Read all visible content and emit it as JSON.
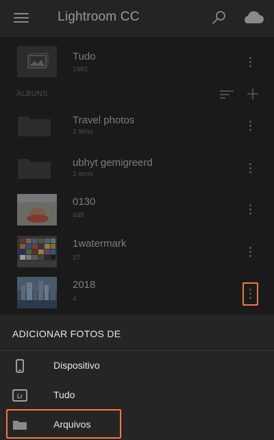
{
  "header": {
    "title": "Lightroom CC",
    "menu_icon": "hamburger-icon",
    "search_icon": "search-icon",
    "cloud_icon": "cloud-icon"
  },
  "all_photos": {
    "title": "Tudo",
    "count": "1982"
  },
  "albums_section": {
    "label": "ÁLBUNS"
  },
  "albums": [
    {
      "title": "Travel photos",
      "subtitle": "2 itens",
      "kind": "folder"
    },
    {
      "title": "ubhyt gemigreerd",
      "subtitle": "2 itens",
      "kind": "folder"
    },
    {
      "title": "0130",
      "subtitle": "448",
      "kind": "photo"
    },
    {
      "title": "1watermark",
      "subtitle": "27",
      "kind": "photo"
    },
    {
      "title": "2018",
      "subtitle": "4",
      "kind": "photo"
    }
  ],
  "sheet": {
    "title": "ADICIONAR FOTOS DE",
    "items": [
      {
        "label": "Dispositivo",
        "icon": "phone-icon"
      },
      {
        "label": "Tudo",
        "icon": "lr-icon",
        "icon_text": "Lr"
      },
      {
        "label": "Arquivos",
        "icon": "folder-icon"
      }
    ]
  },
  "colors": {
    "accent": "#f47a3a",
    "sheet_bg": "#252525",
    "page_bg": "#1a1a1a"
  }
}
